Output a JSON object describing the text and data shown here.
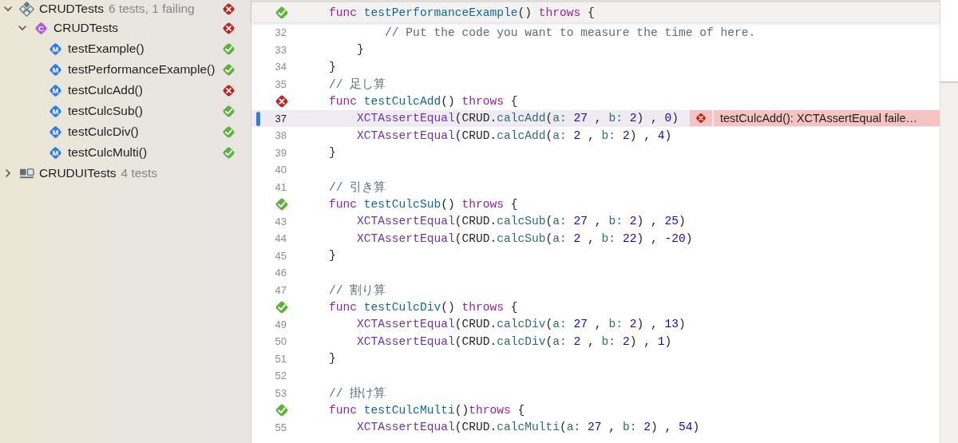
{
  "sidebar": {
    "items": [
      {
        "kind": "target",
        "label": "CRUDTests",
        "detail": "6 tests, 1 failing",
        "passed": false,
        "expanded": true,
        "children": [
          {
            "kind": "class",
            "badge": "C",
            "label": "CRUDTests",
            "passed": false,
            "expanded": true,
            "children": [
              {
                "kind": "method",
                "badge": "M",
                "label": "testExample()",
                "passed": true
              },
              {
                "kind": "method",
                "badge": "M",
                "label": "testPerformanceExample()",
                "passed": true
              },
              {
                "kind": "method",
                "badge": "M",
                "label": "testCulcAdd()",
                "passed": false
              },
              {
                "kind": "method",
                "badge": "M",
                "label": "testCulcSub()",
                "passed": true
              },
              {
                "kind": "method",
                "badge": "M",
                "label": "testCulcDiv()",
                "passed": true
              },
              {
                "kind": "method",
                "badge": "M",
                "label": "testCulcMulti()",
                "passed": true
              }
            ]
          }
        ]
      },
      {
        "kind": "ui_target",
        "label": "CRUDUITests",
        "detail": "4 tests",
        "expanded": false
      }
    ]
  },
  "editor": {
    "sticky_header": {
      "passed": true,
      "tokens": [
        {
          "kind": "keyword",
          "text": "    func"
        },
        {
          "kind": "name",
          "text": " testPerformanceExample"
        },
        {
          "kind": "plain",
          "text": "() "
        },
        {
          "kind": "keyword",
          "text": "throws"
        },
        {
          "kind": "plain",
          "text": " {"
        }
      ]
    },
    "lines": [
      {
        "number": "32",
        "tokens": [
          {
            "kind": "comment",
            "text": "            // Put the code you want to measure the time of here."
          }
        ]
      },
      {
        "number": "33",
        "tokens": [
          {
            "kind": "plain",
            "text": "        }"
          }
        ]
      },
      {
        "number": "34",
        "tokens": [
          {
            "kind": "plain",
            "text": "    }"
          }
        ]
      },
      {
        "number": "35",
        "tokens": [
          {
            "kind": "comment",
            "text": "    // 足し算"
          }
        ]
      },
      {
        "passed": false,
        "tokens": [
          {
            "kind": "keyword",
            "text": "    func"
          },
          {
            "kind": "name",
            "text": " testCulcAdd"
          },
          {
            "kind": "plain",
            "text": "() "
          },
          {
            "kind": "keyword",
            "text": "throws"
          },
          {
            "kind": "plain",
            "text": " {"
          }
        ]
      },
      {
        "number": "37",
        "current": true,
        "tokens": [
          {
            "kind": "type",
            "text": "        XCTAssertEqual"
          },
          {
            "kind": "plain",
            "text": "(CRUD."
          },
          {
            "kind": "call",
            "text": "calcAdd"
          },
          {
            "kind": "plain",
            "text": "("
          },
          {
            "kind": "label",
            "text": "a:"
          },
          {
            "kind": "number",
            "text": " 27"
          },
          {
            "kind": "plain",
            "text": " , "
          },
          {
            "kind": "label",
            "text": "b:"
          },
          {
            "kind": "number",
            "text": " 2"
          },
          {
            "kind": "plain",
            "text": ") , "
          },
          {
            "kind": "number",
            "text": "0"
          },
          {
            "kind": "plain",
            "text": ")"
          }
        ],
        "annotation": {
          "passed": false,
          "text": "testCulcAdd(): XCTAssertEqual faile…"
        }
      },
      {
        "number": "38",
        "tokens": [
          {
            "kind": "type",
            "text": "        XCTAssertEqual"
          },
          {
            "kind": "plain",
            "text": "(CRUD."
          },
          {
            "kind": "call",
            "text": "calcAdd"
          },
          {
            "kind": "plain",
            "text": "("
          },
          {
            "kind": "label",
            "text": "a:"
          },
          {
            "kind": "number",
            "text": " 2"
          },
          {
            "kind": "plain",
            "text": " , "
          },
          {
            "kind": "label",
            "text": "b:"
          },
          {
            "kind": "number",
            "text": " 2"
          },
          {
            "kind": "plain",
            "text": ") , "
          },
          {
            "kind": "number",
            "text": "4"
          },
          {
            "kind": "plain",
            "text": ")"
          }
        ]
      },
      {
        "number": "39",
        "tokens": [
          {
            "kind": "plain",
            "text": "    }"
          }
        ]
      },
      {
        "number": "40"
      },
      {
        "number": "41",
        "tokens": [
          {
            "kind": "comment",
            "text": "    // 引き算"
          }
        ]
      },
      {
        "passed": true,
        "tokens": [
          {
            "kind": "keyword",
            "text": "    func"
          },
          {
            "kind": "name",
            "text": " testCulcSub"
          },
          {
            "kind": "plain",
            "text": "() "
          },
          {
            "kind": "keyword",
            "text": "throws"
          },
          {
            "kind": "plain",
            "text": " {"
          }
        ]
      },
      {
        "number": "43",
        "tokens": [
          {
            "kind": "type",
            "text": "        XCTAssertEqual"
          },
          {
            "kind": "plain",
            "text": "(CRUD."
          },
          {
            "kind": "call",
            "text": "calcSub"
          },
          {
            "kind": "plain",
            "text": "("
          },
          {
            "kind": "label",
            "text": "a:"
          },
          {
            "kind": "number",
            "text": " 27"
          },
          {
            "kind": "plain",
            "text": " , "
          },
          {
            "kind": "label",
            "text": "b:"
          },
          {
            "kind": "number",
            "text": " 2"
          },
          {
            "kind": "plain",
            "text": ") , "
          },
          {
            "kind": "number",
            "text": "25"
          },
          {
            "kind": "plain",
            "text": ")"
          }
        ]
      },
      {
        "number": "44",
        "tokens": [
          {
            "kind": "type",
            "text": "        XCTAssertEqual"
          },
          {
            "kind": "plain",
            "text": "(CRUD."
          },
          {
            "kind": "call",
            "text": "calcSub"
          },
          {
            "kind": "plain",
            "text": "("
          },
          {
            "kind": "label",
            "text": "a:"
          },
          {
            "kind": "number",
            "text": " 2"
          },
          {
            "kind": "plain",
            "text": " , "
          },
          {
            "kind": "label",
            "text": "b:"
          },
          {
            "kind": "number",
            "text": " 22"
          },
          {
            "kind": "plain",
            "text": ") , "
          },
          {
            "kind": "number",
            "text": "-20"
          },
          {
            "kind": "plain",
            "text": ")"
          }
        ]
      },
      {
        "number": "45",
        "tokens": [
          {
            "kind": "plain",
            "text": "    }"
          }
        ]
      },
      {
        "number": "46"
      },
      {
        "number": "47",
        "tokens": [
          {
            "kind": "comment",
            "text": "    // 割り算"
          }
        ]
      },
      {
        "passed": true,
        "tokens": [
          {
            "kind": "keyword",
            "text": "    func"
          },
          {
            "kind": "name",
            "text": " testCulcDiv"
          },
          {
            "kind": "plain",
            "text": "() "
          },
          {
            "kind": "keyword",
            "text": "throws"
          },
          {
            "kind": "plain",
            "text": " {"
          }
        ]
      },
      {
        "number": "49",
        "tokens": [
          {
            "kind": "type",
            "text": "        XCTAssertEqual"
          },
          {
            "kind": "plain",
            "text": "(CRUD."
          },
          {
            "kind": "call",
            "text": "calcDiv"
          },
          {
            "kind": "plain",
            "text": "("
          },
          {
            "kind": "label",
            "text": "a:"
          },
          {
            "kind": "number",
            "text": " 27"
          },
          {
            "kind": "plain",
            "text": " , "
          },
          {
            "kind": "label",
            "text": "b:"
          },
          {
            "kind": "number",
            "text": " 2"
          },
          {
            "kind": "plain",
            "text": ") , "
          },
          {
            "kind": "number",
            "text": "13"
          },
          {
            "kind": "plain",
            "text": ")"
          }
        ]
      },
      {
        "number": "50",
        "tokens": [
          {
            "kind": "type",
            "text": "        XCTAssertEqual"
          },
          {
            "kind": "plain",
            "text": "(CRUD."
          },
          {
            "kind": "call",
            "text": "calcDiv"
          },
          {
            "kind": "plain",
            "text": "("
          },
          {
            "kind": "label",
            "text": "a:"
          },
          {
            "kind": "number",
            "text": " 2"
          },
          {
            "kind": "plain",
            "text": " , "
          },
          {
            "kind": "label",
            "text": "b:"
          },
          {
            "kind": "number",
            "text": " 2"
          },
          {
            "kind": "plain",
            "text": ") , "
          },
          {
            "kind": "number",
            "text": "1"
          },
          {
            "kind": "plain",
            "text": ")"
          }
        ]
      },
      {
        "number": "51",
        "tokens": [
          {
            "kind": "plain",
            "text": "    }"
          }
        ]
      },
      {
        "number": "52"
      },
      {
        "number": "53",
        "tokens": [
          {
            "kind": "comment",
            "text": "    // 掛け算"
          }
        ]
      },
      {
        "passed": true,
        "tokens": [
          {
            "kind": "keyword",
            "text": "    func"
          },
          {
            "kind": "name",
            "text": " testCulcMulti"
          },
          {
            "kind": "plain",
            "text": "()"
          },
          {
            "kind": "keyword",
            "text": "throws"
          },
          {
            "kind": "plain",
            "text": " {"
          }
        ]
      },
      {
        "number": "55",
        "tokens": [
          {
            "kind": "type",
            "text": "        XCTAssertEqual"
          },
          {
            "kind": "plain",
            "text": "(CRUD."
          },
          {
            "kind": "call",
            "text": "calcMulti"
          },
          {
            "kind": "plain",
            "text": "("
          },
          {
            "kind": "label",
            "text": "a:"
          },
          {
            "kind": "number",
            "text": " 27"
          },
          {
            "kind": "plain",
            "text": " , "
          },
          {
            "kind": "label",
            "text": "b:"
          },
          {
            "kind": "number",
            "text": " 2"
          },
          {
            "kind": "plain",
            "text": ") , "
          },
          {
            "kind": "number",
            "text": "54"
          },
          {
            "kind": "plain",
            "text": ")"
          }
        ]
      }
    ]
  }
}
